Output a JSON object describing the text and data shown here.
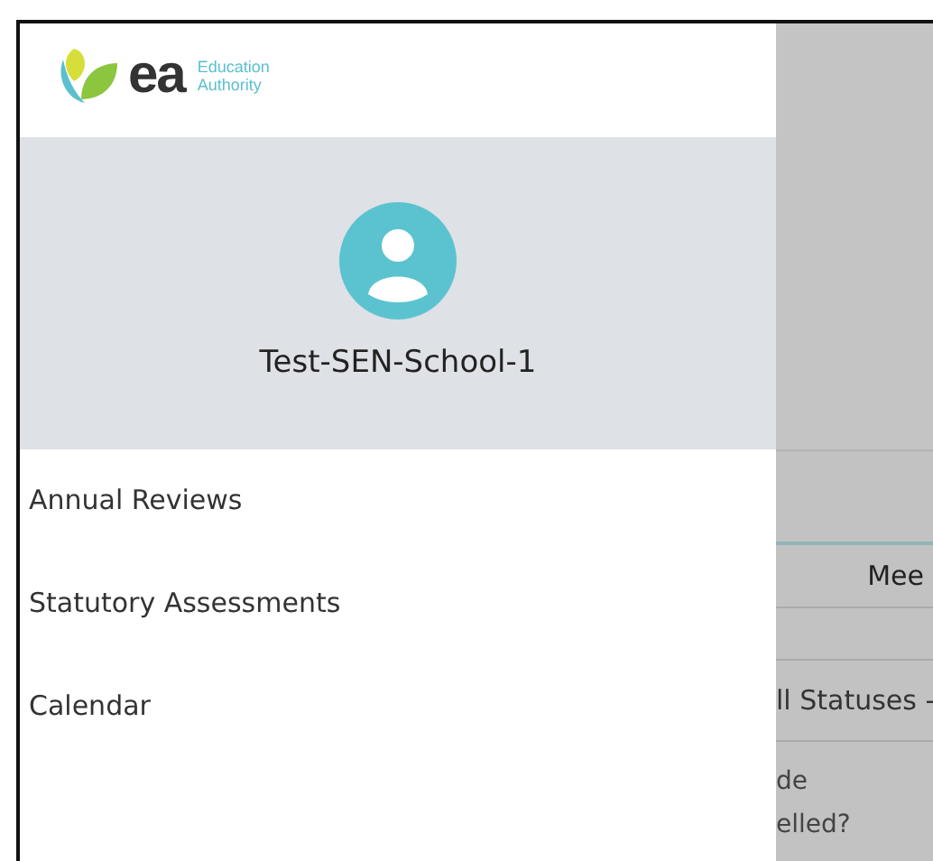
{
  "logo": {
    "mark": "ea",
    "line_1": "Education",
    "line_2": "Authority"
  },
  "profile": {
    "name": "Test-SEN-School-1"
  },
  "menu": [
    {
      "label": "Annual Reviews"
    },
    {
      "label": "Statutory Assessments"
    },
    {
      "label": "Calendar"
    }
  ],
  "background": {
    "column_header": "Mee",
    "filter": "ll Statuses -",
    "text_1": "de",
    "text_2": "elled?"
  }
}
